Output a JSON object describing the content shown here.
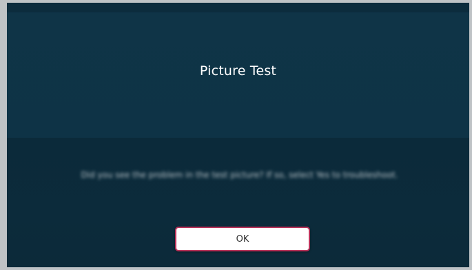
{
  "dialog": {
    "title": "Picture Test",
    "message": "Did you see the problem in the test picture? If so, select Yes to troubleshoot.",
    "ok_label": "OK"
  },
  "colors": {
    "dialog_background": "#0f3346",
    "lower_panel_background": "#0b2a3a",
    "button_background": "#ffffff",
    "button_focus_border": "#b9335a"
  }
}
